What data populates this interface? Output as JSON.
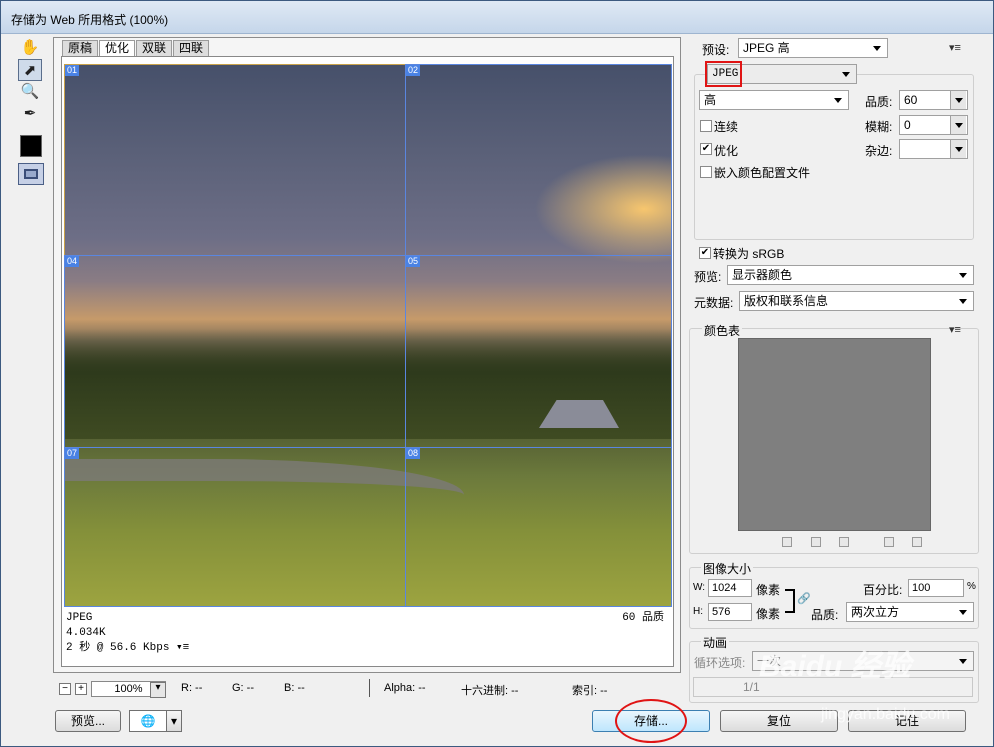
{
  "window": {
    "title": "存储为 Web 所用格式 (100%)"
  },
  "tabs": [
    "原稿",
    "优化",
    "双联",
    "四联"
  ],
  "slices": [
    "01",
    "02",
    "04",
    "05",
    "07",
    "08"
  ],
  "info": {
    "format": "JPEG",
    "size": "4.034K",
    "time": "2 秒 @ 56.6 Kbps",
    "quality": "60 品质"
  },
  "status": {
    "zoom": "100%",
    "r": "R: --",
    "g": "G: --",
    "b": "B: --",
    "alpha": "Alpha: --",
    "hex": "十六进制: --",
    "index": "索引: --"
  },
  "buttons": {
    "preview": "预览...",
    "save": "存储...",
    "reset": "复位",
    "remember": "记住"
  },
  "settings": {
    "preset_label": "预设:",
    "preset": "JPEG 高",
    "format": "JPEG",
    "quality_level": "高",
    "quality_label": "品质:",
    "quality": "60",
    "blur_label": "模糊:",
    "blur": "0",
    "matte_label": "杂边:",
    "progressive": "连续",
    "optimized": "优化",
    "embed_profile": "嵌入颜色配置文件",
    "convert_srgb": "转换为 sRGB",
    "preview_label": "预览:",
    "preview_value": "显示器颜色",
    "metadata_label": "元数据:",
    "metadata_value": "版权和联系信息"
  },
  "color_table": {
    "title": "颜色表"
  },
  "image_size": {
    "title": "图像大小",
    "w_label": "W:",
    "w": "1024",
    "h_label": "H:",
    "h": "576",
    "unit": "像素",
    "percent_label": "百分比:",
    "percent": "100",
    "percent_unit": "%",
    "quality_label": "品质:",
    "quality": "两次立方"
  },
  "animation": {
    "title": "动画",
    "loop_label": "循环选项:",
    "loop": "一次",
    "frame": "1/1"
  },
  "watermark": {
    "logo": "Baidu 经验",
    "url": "jingyan.baidu.com"
  }
}
